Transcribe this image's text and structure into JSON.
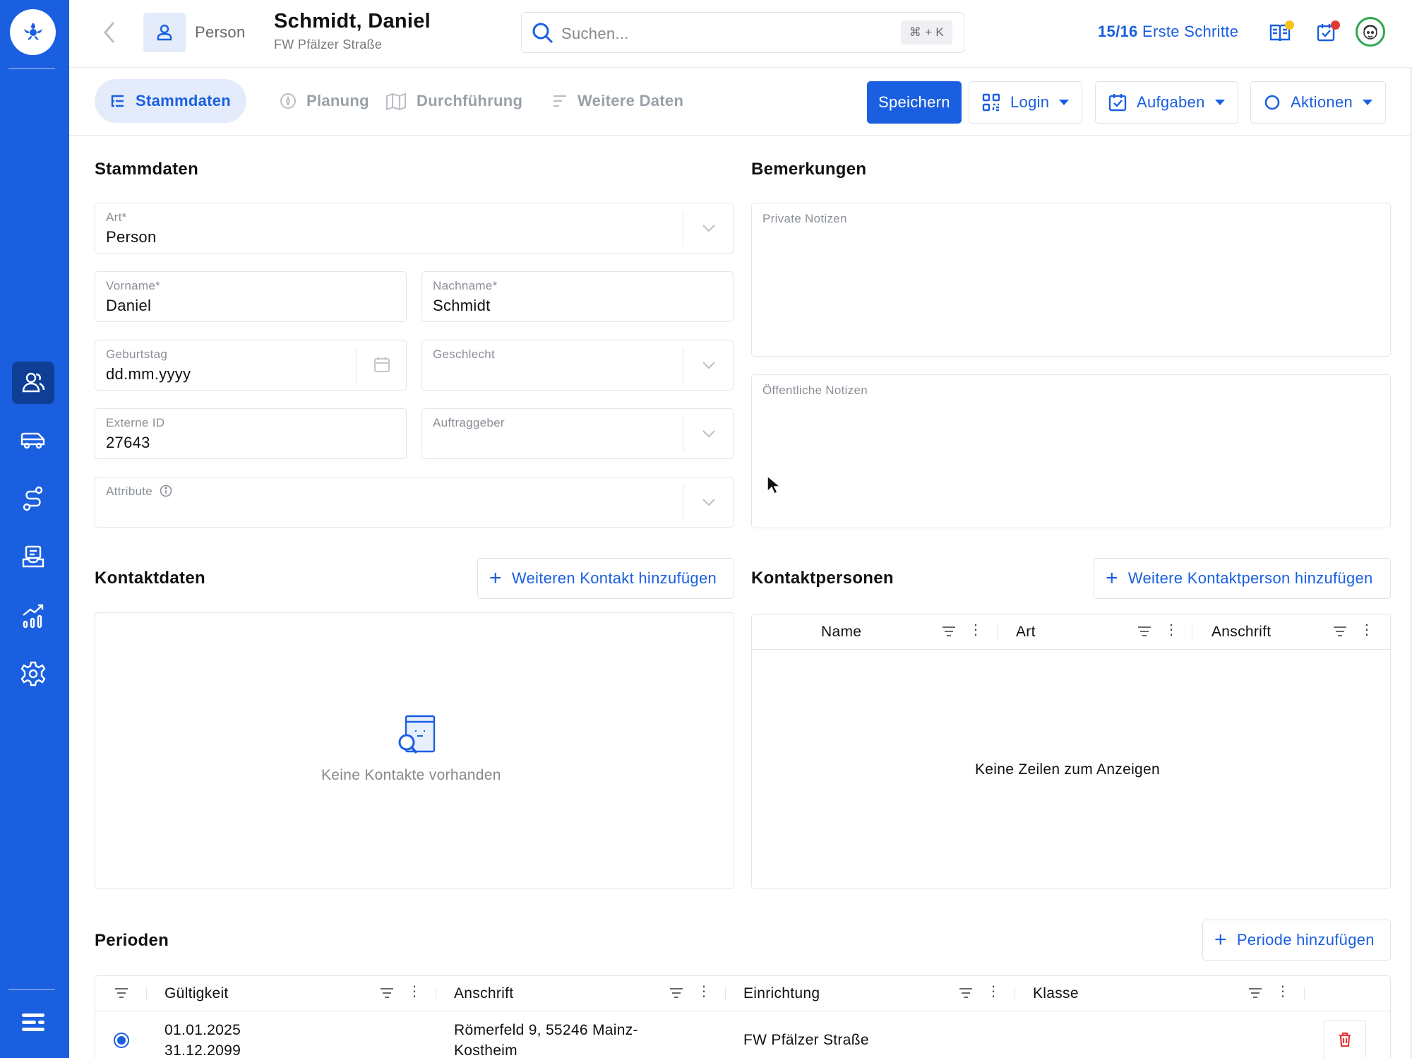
{
  "colors": {
    "brand": "#1a5fe0",
    "sidebar": "#1a5fe0",
    "sidebar_active": "#0f3e96",
    "danger": "#e53935",
    "avatar_ring": "#2fa84f"
  },
  "sidebar": {
    "items": [
      {
        "icon": "people-icon",
        "active": true
      },
      {
        "icon": "van-icon",
        "active": false
      },
      {
        "icon": "route-icon",
        "active": false
      },
      {
        "icon": "inbox-icon",
        "active": false
      },
      {
        "icon": "analytics-icon",
        "active": false
      },
      {
        "icon": "gear-icon",
        "active": false
      }
    ],
    "bottom_icon": "menu-lines-icon"
  },
  "header": {
    "entity_label": "Person",
    "title": "Schmidt, Daniel",
    "subtitle": "FW Pfälzer Straße",
    "search_placeholder": "Suchen...",
    "search_shortcut": "⌘ + K",
    "steps_count": "15/16",
    "steps_label": "Erste Schritte"
  },
  "tabs": [
    {
      "label": "Stammdaten",
      "active": true
    },
    {
      "label": "Planung",
      "active": false
    },
    {
      "label": "Durchführung",
      "active": false
    },
    {
      "label": "Weitere Daten",
      "active": false
    }
  ],
  "toolbar": {
    "save_label": "Speichern",
    "login_label": "Login",
    "tasks_label": "Aufgaben",
    "actions_label": "Aktionen"
  },
  "stammdaten": {
    "title": "Stammdaten",
    "art_label": "Art*",
    "art_value": "Person",
    "vorname_label": "Vorname*",
    "vorname_value": "Daniel",
    "nachname_label": "Nachname*",
    "nachname_value": "Schmidt",
    "geburtstag_label": "Geburtstag",
    "geburtstag_value": "dd.mm.yyyy",
    "geschlecht_label": "Geschlecht",
    "geschlecht_value": "",
    "externe_id_label": "Externe ID",
    "externe_id_value": "27643",
    "auftraggeber_label": "Auftraggeber",
    "auftraggeber_value": "",
    "attribute_label": "Attribute"
  },
  "bemerkungen": {
    "title": "Bemerkungen",
    "private_label": "Private Notizen",
    "public_label": "Öffentliche Notizen"
  },
  "kontaktdaten": {
    "title": "Kontaktdaten",
    "add_label": "Weiteren Kontakt hinzufügen",
    "empty_text": "Keine Kontakte vorhanden"
  },
  "kontaktpersonen": {
    "title": "Kontaktpersonen",
    "add_label": "Weitere Kontaktperson hinzufügen",
    "columns": [
      "Name",
      "Art",
      "Anschrift"
    ],
    "empty_text": "Keine Zeilen zum Anzeigen"
  },
  "perioden": {
    "title": "Perioden",
    "add_label": "Periode hinzufügen",
    "columns": [
      "Gültigkeit",
      "Anschrift",
      "Einrichtung",
      "Klasse"
    ],
    "rows": [
      {
        "selected": true,
        "valid_from": "01.01.2025",
        "valid_to": "31.12.2099",
        "address_line1": "Römerfeld 9, 55246 Mainz-",
        "address_line2": "Kostheim",
        "facility": "FW Pfälzer Straße",
        "class": ""
      }
    ]
  }
}
